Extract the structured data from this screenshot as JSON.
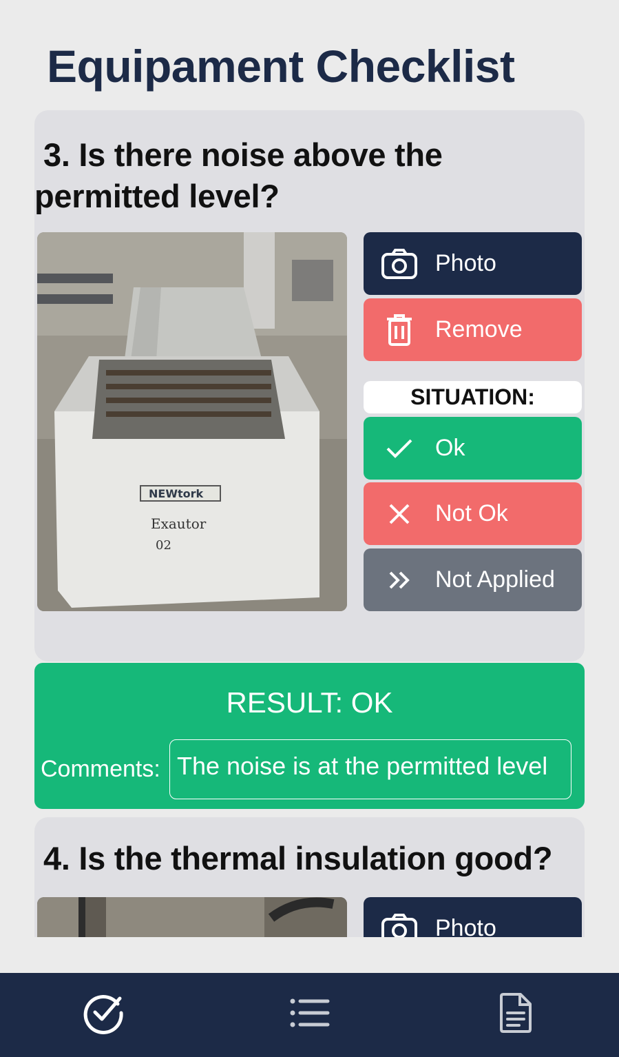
{
  "header": {
    "title": "Equipament Checklist"
  },
  "questions": [
    {
      "number_text": "3. Is there noise above the",
      "text_line2": "permitted level?",
      "photo_button": "Photo",
      "remove_button": "Remove",
      "situation_label": "SITUATION:",
      "options": {
        "ok": "Ok",
        "not_ok": "Not Ok",
        "not_applied": "Not Applied"
      },
      "result": "RESULT: OK",
      "comments_label": "Comments:",
      "comments_value": "The noise is at the permitted level"
    },
    {
      "text": "4. Is the thermal insulation good?",
      "photo_button": "Photo"
    }
  ],
  "icons": {
    "photo": "camera-icon",
    "remove": "trash-icon",
    "ok": "check-icon",
    "not_ok": "x-icon",
    "not_applied": "double-chevron-right-icon",
    "nav": [
      "check-circle-icon",
      "list-icon",
      "document-icon"
    ]
  },
  "colors": {
    "navy": "#1c2a47",
    "green": "#16b879",
    "red": "#f26b6b",
    "gray": "#6c737e"
  }
}
